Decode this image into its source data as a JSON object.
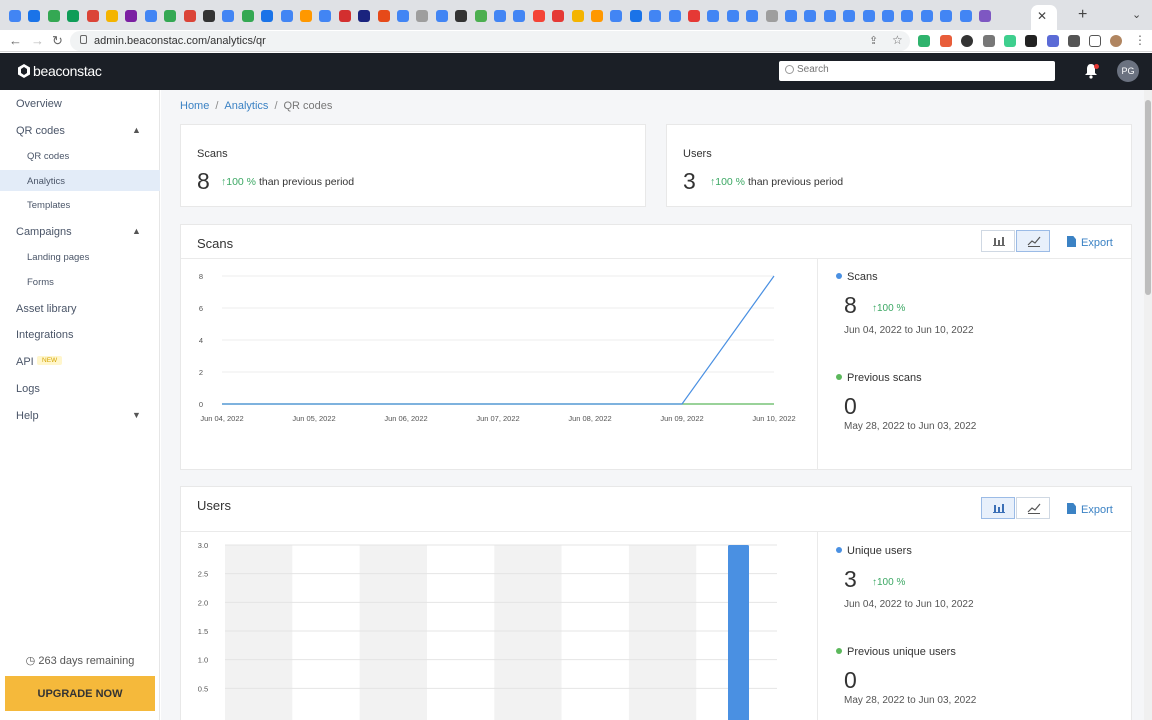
{
  "browser": {
    "url": "admin.beaconstac.com/analytics/qr",
    "tab_favicon_colors": [
      "#4285f4",
      "#1a73e8",
      "#34a853",
      "#0f9d58",
      "#db4437",
      "#f4b400",
      "#7b1fa2",
      "#4285f4",
      "#34a853",
      "#db4437",
      "#333333",
      "#4285f4",
      "#34a853",
      "#1a73e8",
      "#4285f4",
      "#ff9800",
      "#4285f4",
      "#d32f2f",
      "#1a237e",
      "#e64a19",
      "#4285f4",
      "#9e9e9e",
      "#4285f4",
      "#333333",
      "#4caf50",
      "#4285f4",
      "#4285f4",
      "#f44336",
      "#e53935",
      "#f4b400",
      "#ff9800",
      "#4285f4",
      "#1a73e8",
      "#4285f4",
      "#4285f4",
      "#e53935",
      "#4285f4",
      "#4285f4",
      "#4285f4",
      "#9e9e9e",
      "#4285f4",
      "#4285f4",
      "#4285f4",
      "#4285f4",
      "#4285f4",
      "#4285f4",
      "#4285f4",
      "#4285f4",
      "#4285f4",
      "#4285f4",
      "#7e57c2"
    ]
  },
  "app": {
    "logo": "beaconstac",
    "search_placeholder": "Search",
    "avatar_initials": "PG"
  },
  "sidebar": {
    "overview": "Overview",
    "qr_codes": "QR codes",
    "qr_codes_sub": "QR codes",
    "analytics": "Analytics",
    "templates": "Templates",
    "campaigns": "Campaigns",
    "landing_pages": "Landing pages",
    "forms": "Forms",
    "asset_library": "Asset library",
    "integrations": "Integrations",
    "api": "API",
    "api_badge": "NEW",
    "logs": "Logs",
    "help": "Help",
    "days_remaining": "263 days remaining",
    "upgrade": "UPGRADE NOW"
  },
  "breadcrumb": {
    "home": "Home",
    "analytics": "Analytics",
    "current": "QR codes"
  },
  "stats": {
    "scans": {
      "label": "Scans",
      "value": "8",
      "change": "↑100 %",
      "suffix": "than previous period"
    },
    "users": {
      "label": "Users",
      "value": "3",
      "change": "↑100 %",
      "suffix": "than previous period"
    }
  },
  "scans_panel": {
    "title": "Scans",
    "export": "Export",
    "current": {
      "label": "Scans",
      "value": "8",
      "change": "↑100 %",
      "range": "Jun 04, 2022 to Jun 10, 2022",
      "color": "#4a90e2"
    },
    "previous": {
      "label": "Previous scans",
      "value": "0",
      "range": "May 28, 2022 to Jun 03, 2022",
      "color": "#5cb85c"
    }
  },
  "users_panel": {
    "title": "Users",
    "export": "Export",
    "current": {
      "label": "Unique users",
      "value": "3",
      "change": "↑100 %",
      "range": "Jun 04, 2022 to Jun 10, 2022",
      "color": "#4a90e2"
    },
    "previous": {
      "label": "Previous unique users",
      "value": "0",
      "range": "May 28, 2022 to Jun 03, 2022",
      "color": "#5cb85c"
    }
  },
  "chart_data": [
    {
      "type": "line",
      "x": [
        "Jun 04, 2022",
        "Jun 05, 2022",
        "Jun 06, 2022",
        "Jun 07, 2022",
        "Jun 08, 2022",
        "Jun 09, 2022",
        "Jun 10, 2022"
      ],
      "series": [
        {
          "name": "Scans",
          "values": [
            0,
            0,
            0,
            0,
            0,
            0,
            8
          ],
          "color": "#4a90e2"
        },
        {
          "name": "Previous scans",
          "values": [
            0,
            0,
            0,
            0,
            0,
            0,
            0
          ],
          "color": "#5cb85c"
        }
      ],
      "yticks": [
        "0",
        "2",
        "4",
        "6",
        "8"
      ],
      "ylim": [
        0,
        8
      ],
      "grid": true
    },
    {
      "type": "bar",
      "categories": [
        "",
        "",
        "",
        "",
        "",
        "",
        "",
        ""
      ],
      "series": [
        {
          "name": "Unique users",
          "values": [
            0,
            0,
            0,
            0,
            0,
            0,
            0,
            3
          ],
          "color": "#4a90e2"
        }
      ],
      "yticks": [
        "0.5",
        "1.0",
        "1.5",
        "2.0",
        "2.5",
        "3.0"
      ],
      "ylim": [
        0,
        3.0
      ],
      "grid": true
    }
  ]
}
